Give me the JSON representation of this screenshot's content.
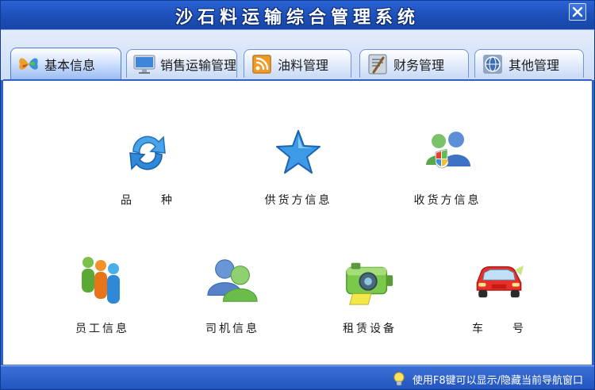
{
  "window": {
    "title": "沙石料运输综合管理系统",
    "close_icon": "close-icon"
  },
  "tabs": [
    {
      "label": "基本信息",
      "icon": "butterfly-icon",
      "active": true
    },
    {
      "label": "销售运输管理",
      "icon": "monitor-icon",
      "active": false
    },
    {
      "label": "油料管理",
      "icon": "rss-icon",
      "active": false
    },
    {
      "label": "财务管理",
      "icon": "document-icon",
      "active": false
    },
    {
      "label": "其他管理",
      "icon": "globe-icon",
      "active": false
    }
  ],
  "items": [
    {
      "label": "品　　种",
      "icon": "refresh-arrows-icon"
    },
    {
      "label": "供货方信息",
      "icon": "star-icon"
    },
    {
      "label": "收货方信息",
      "icon": "users-shield-icon"
    },
    {
      "label": "员工信息",
      "icon": "people-group-icon"
    },
    {
      "label": "司机信息",
      "icon": "two-users-icon"
    },
    {
      "label": "租赁设备",
      "icon": "camera-icon"
    },
    {
      "label": "车　　号",
      "icon": "car-icon"
    }
  ],
  "status": {
    "hint": "使用F8键可以显示/隐藏当前导航窗口",
    "hint_icon": "lightbulb-icon"
  },
  "colors": {
    "title_bar": "#1d4fb8",
    "frame": "#2f62c8",
    "tabstrip": "#d6e3f8",
    "content_bg": "#ffffff"
  }
}
